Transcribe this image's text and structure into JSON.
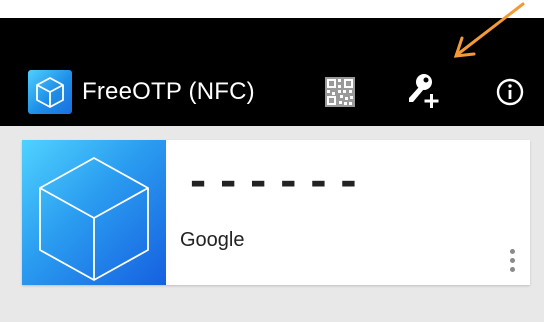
{
  "action_bar": {
    "title": "FreeOTP (NFC)",
    "background": "#000000",
    "actions": [
      {
        "icon": "qr-code-icon"
      },
      {
        "icon": "key-plus-icon"
      },
      {
        "icon": "info-icon"
      }
    ]
  },
  "token": {
    "code": "------",
    "label": "Google",
    "image_icon": "cube-icon",
    "image_gradient": [
      "#4fd2ff",
      "#1660e0"
    ],
    "menu_icon": "overflow-menu-icon"
  },
  "annotation": {
    "arrow_color": "#f29a38",
    "target": "key-plus-icon"
  }
}
